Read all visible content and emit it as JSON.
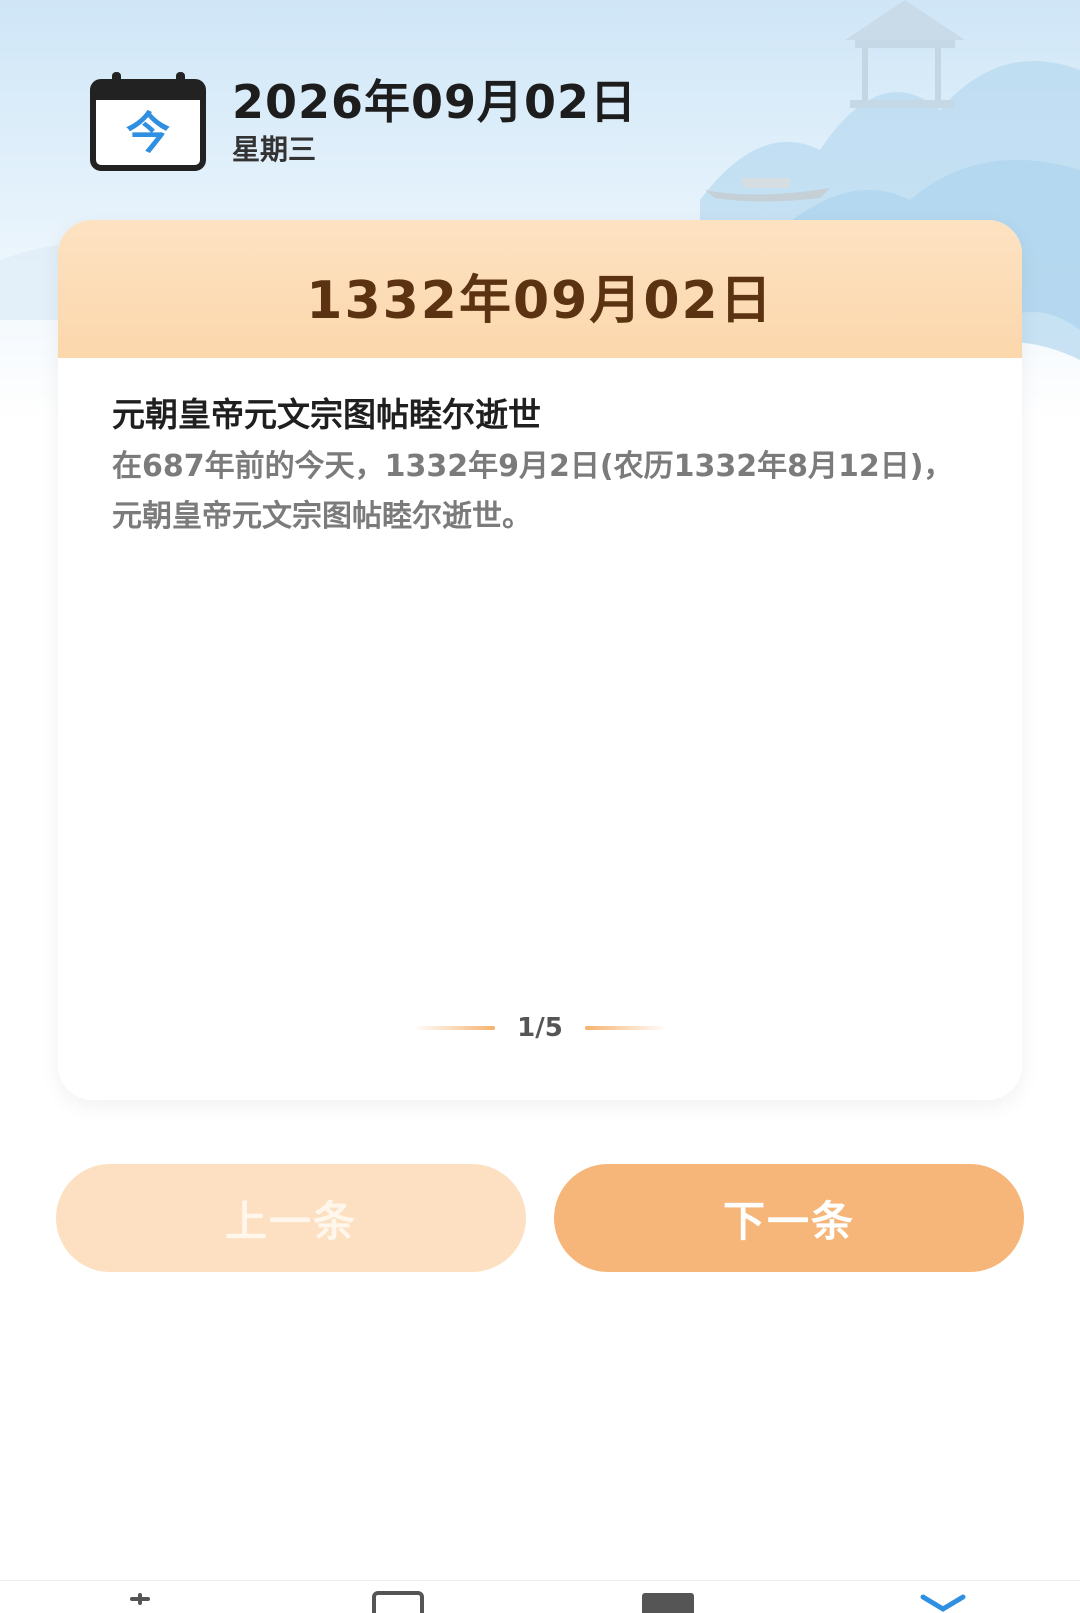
{
  "header": {
    "calendar_icon_char": "今",
    "date": "2026年09月02日",
    "weekday": "星期三"
  },
  "card": {
    "history_date": "1332年09月02日",
    "event_title": "元朝皇帝元文宗图帖睦尔逝世",
    "event_description": "在687年前的今天，1332年9月2日(农历1332年8月12日)，元朝皇帝元文宗图帖睦尔逝世。",
    "pager": "1/5"
  },
  "buttons": {
    "prev_label": "上一条",
    "next_label": "下一条"
  },
  "tabbar": {
    "icons": [
      "tab-1-icon",
      "tab-2-icon",
      "tab-3-icon",
      "tab-4-icon"
    ]
  },
  "colors": {
    "card_header": "#fcd7ac",
    "date_text": "#5b3212",
    "next_button": "#f6b67a",
    "prev_button": "#fde0c2",
    "calendar_accent": "#2f8fe0"
  }
}
